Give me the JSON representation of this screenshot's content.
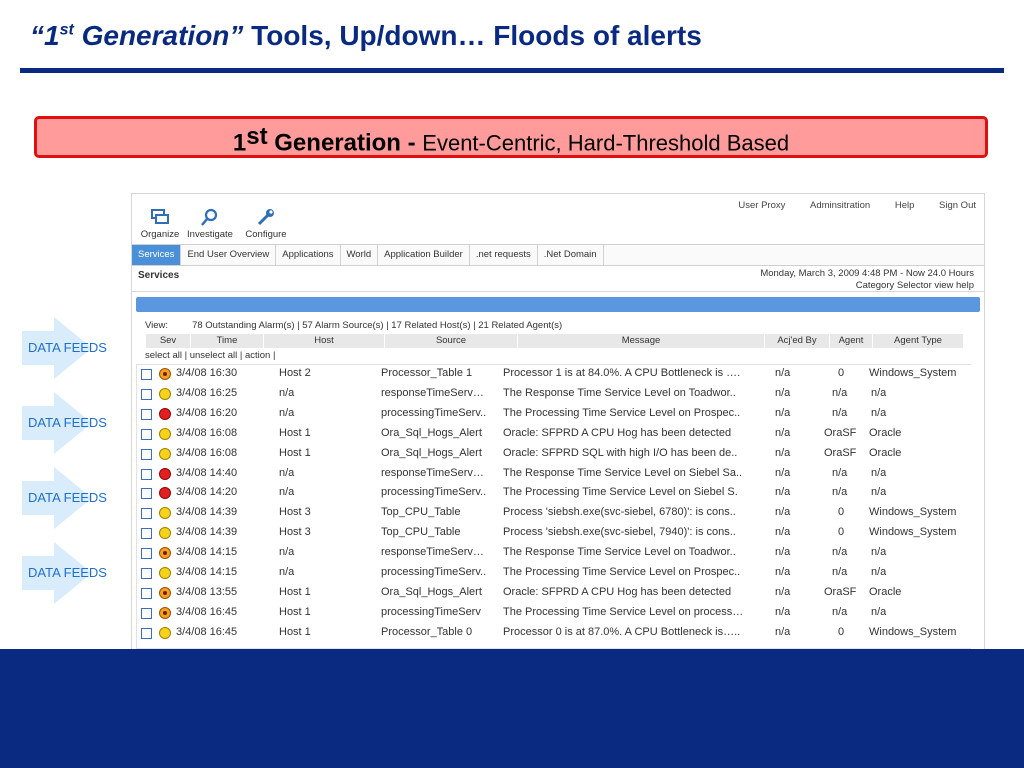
{
  "slide": {
    "title_quote": "“1",
    "title_sup": "st",
    "title_italic_rest": " Generation”",
    "title_rest": " Tools, Up/down… Floods of alerts",
    "banner_bold": "1",
    "banner_sup": "st",
    "banner_bold_rest": " Generation - ",
    "banner_rest": "Event-Centric, Hard-Threshold Based",
    "feed_label": "DATA FEEDS",
    "title_color": "#0a2a82",
    "banner_fill": "#ff9b9b",
    "banner_border": "#e01010",
    "feed_color": "#1d6fd0"
  },
  "app": {
    "topnav": [
      "User Proxy",
      "Adminsitration",
      "Help",
      "Sign Out"
    ],
    "tools": [
      {
        "label": "Organize",
        "icon": "organize-icon"
      },
      {
        "label": "Investigate",
        "icon": "magnifier-icon"
      },
      {
        "label": "Configure",
        "icon": "wrench-icon"
      }
    ],
    "tabs": [
      "Services",
      "End User Overview",
      "Applications",
      "World",
      "Application Builder",
      ".net requests",
      ".Net Domain"
    ],
    "section_title": "Services",
    "date_line": "Monday, March 3, 2009  4:48 PM - Now 24.0 Hours",
    "selector_line": "Category Selector view  help",
    "view_label": "View:",
    "view_summary": "78  Outstanding Alarm(s) | 57 Alarm Source(s) | 17 Related Host(s)  | 21 Related Agent(s)",
    "select_line": "select all | unselect all | action |",
    "columns": [
      "Sev",
      "Time",
      "Host",
      "Source",
      "Message",
      "Acj'ed By",
      "Agent",
      "Agent Type"
    ],
    "rows": [
      {
        "sev": "orange",
        "time": "3/4/08 16:30",
        "host": "Host 2",
        "source": "Processor_Table 1",
        "message": "Processor 1 is at 84.0%. A CPU Bottleneck is ….",
        "ack": "n/a",
        "agent": "0",
        "type": "Windows_System"
      },
      {
        "sev": "yellow",
        "time": "3/4/08 16:25",
        "host": "n/a",
        "source": "responseTimeServ…",
        "message": "The Response Time Service Level on Toadwor..",
        "ack": "n/a",
        "agent": "n/a",
        "type": "n/a"
      },
      {
        "sev": "red",
        "time": "3/4/08 16:20",
        "host": "n/a",
        "source": "processingTimeServ..",
        "message": "The Processing Time Service Level on Prospec..",
        "ack": "n/a",
        "agent": "n/a",
        "type": "n/a"
      },
      {
        "sev": "yellow",
        "time": "3/4/08 16:08",
        "host": "Host 1",
        "source": "Ora_Sql_Hogs_Alert",
        "message": "Oracle: SFPRD A CPU Hog has been detected",
        "ack": "n/a",
        "agent": "OraSF",
        "type": "Oracle"
      },
      {
        "sev": "yellow",
        "time": "3/4/08 16:08",
        "host": "Host 1",
        "source": "Ora_Sql_Hogs_Alert",
        "message": "Oracle: SFPRD SQL with high I/O has been de..",
        "ack": "n/a",
        "agent": "OraSF",
        "type": "Oracle"
      },
      {
        "sev": "red",
        "time": "3/4/08 14:40",
        "host": "n/a",
        "source": "responseTimeServ…",
        "message": "The Response Time Service Level on Siebel Sa..",
        "ack": "n/a",
        "agent": "n/a",
        "type": "n/a"
      },
      {
        "sev": "red",
        "time": "3/4/08 14:20",
        "host": "n/a",
        "source": "processingTimeServ..",
        "message": "The Processing Time Service Level on Siebel S.",
        "ack": "n/a",
        "agent": "n/a",
        "type": "n/a"
      },
      {
        "sev": "yellow",
        "time": "3/4/08 14:39",
        "host": "Host 3",
        "source": "Top_CPU_Table",
        "message": "Process 'siebsh.exe(svc-siebel, 6780)': is cons..",
        "ack": "n/a",
        "agent": "0",
        "type": "Windows_System"
      },
      {
        "sev": "yellow",
        "time": "3/4/08 14:39",
        "host": "Host 3",
        "source": "Top_CPU_Table",
        "message": "Process 'siebsh.exe(svc-siebel, 7940)': is cons..",
        "ack": "n/a",
        "agent": "0",
        "type": "Windows_System"
      },
      {
        "sev": "orange",
        "time": "3/4/08 14:15",
        "host": "n/a",
        "source": "responseTimeServ…",
        "message": "The Response Time Service Level on Toadwor..",
        "ack": "n/a",
        "agent": "n/a",
        "type": "n/a"
      },
      {
        "sev": "yellow",
        "time": "3/4/08 14:15",
        "host": "n/a",
        "source": "processingTimeServ..",
        "message": "The Processing Time Service Level on Prospec..",
        "ack": "n/a",
        "agent": "n/a",
        "type": "n/a"
      },
      {
        "sev": "orange",
        "time": "3/4/08 13:55",
        "host": "Host 1",
        "source": "Ora_Sql_Hogs_Alert",
        "message": "Oracle: SFPRD A CPU Hog has been detected",
        "ack": "n/a",
        "agent": "OraSF",
        "type": "Oracle"
      },
      {
        "sev": "orange",
        "time": "3/4/08 16:45",
        "host": "Host 1",
        "source": "processingTimeServ",
        "message": "The Processing Time Service Level on process…",
        "ack": "n/a",
        "agent": "n/a",
        "type": "n/a"
      },
      {
        "sev": "yellow",
        "time": "3/4/08 16:45",
        "host": "Host 1",
        "source": "Processor_Table 0",
        "message": "Processor 0 is at 87.0%. A CPU Bottleneck is…..",
        "ack": "n/a",
        "agent": "0",
        "type": "Windows_System"
      }
    ]
  }
}
